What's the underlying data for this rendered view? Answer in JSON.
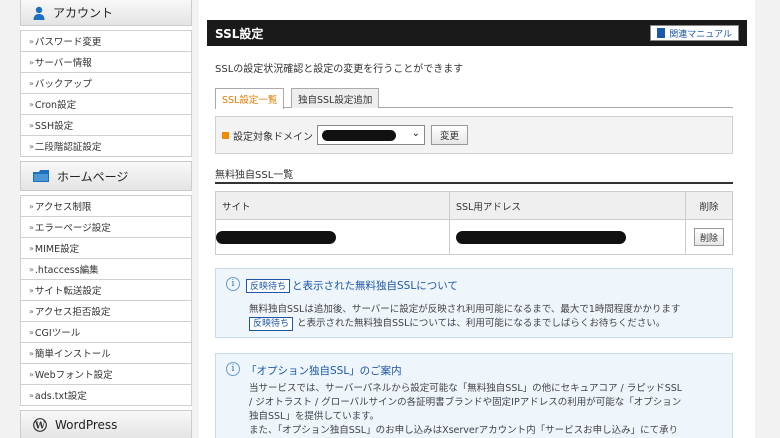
{
  "sidebar": {
    "account_title": "アカウント",
    "account_items": [
      "パスワード変更",
      "サーバー情報",
      "バックアップ",
      "Cron設定",
      "SSH設定",
      "二段階認証設定"
    ],
    "homepage_title": "ホームページ",
    "homepage_items": [
      "アクセス制限",
      "エラーページ設定",
      "MIME設定",
      ".htaccess編集",
      "サイト転送設定",
      "アクセス拒否設定",
      "CGIツール",
      "簡単インストール",
      "Webフォント設定",
      "ads.txt設定"
    ],
    "wordpress_title": "WordPress"
  },
  "header": {
    "title": "SSL設定",
    "manual_label": "関連マニュアル"
  },
  "description": "SSLの設定状況確認と設定の変更を行うことができます",
  "tabs": [
    "SSL設定一覧",
    "独自SSL設定追加"
  ],
  "domain": {
    "label": "設定対象ドメイン",
    "change_button": "変更"
  },
  "list_title": "無料独自SSL一覧",
  "table": {
    "headers": [
      "サイト",
      "SSL用アドレス",
      "削除"
    ],
    "delete_button": "削除"
  },
  "info1": {
    "title_badge": "反映待ち",
    "title_rest": "と表示された無料独自SSLについて",
    "body_line1": "無料独自SSLは追加後、サーバーに設定が反映され利用可能になるまで、最大で1時間程度かかります",
    "body_badge": "反映待ち",
    "body_line2_rest": "と表示された無料独自SSLについては、利用可能になるまでしばらくお待ちください。"
  },
  "info2": {
    "title": "「オプション独自SSL」のご案内",
    "body_line1": "当サービスでは、サーバーパネルから設定可能な「無料独自SSL」の他にセキュアコア / ラピッドSSL",
    "body_line2": "/ ジオトラスト / グローバルサインの各証明書ブランドや固定IPアドレスの利用が可能な「オプション",
    "body_line3": "独自SSL」を提供しています。",
    "body_line4": "また、「オプション独自SSL」のお申し込みはXserverアカウント内「サービスお申し込み」にて承り"
  }
}
